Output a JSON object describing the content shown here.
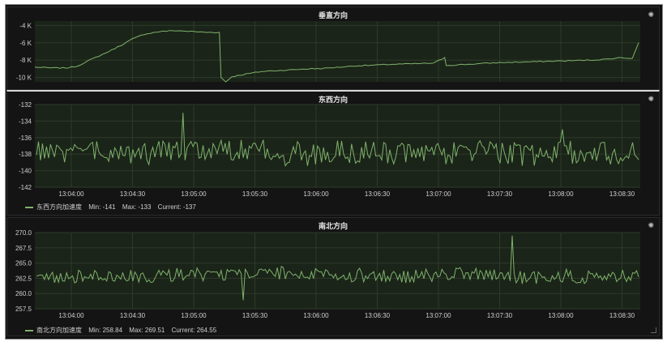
{
  "chart_data": [
    {
      "type": "line",
      "title": "垂直方向",
      "y_ticks": [
        "-4 K",
        "-6 K",
        "-8 K",
        "-10 K"
      ],
      "y_tick_values": [
        -4000,
        -6000,
        -8000,
        -10000
      ],
      "ylim": [
        -10500,
        -3500
      ],
      "xlim": [
        "13:03:30",
        "13:08:48"
      ],
      "series": [
        {
          "values_sketch": [
            [
              0,
              -8800
            ],
            [
              10,
              -8900
            ],
            [
              20,
              -8900
            ],
            [
              27,
              -8700
            ],
            [
              35,
              -8000
            ],
            [
              45,
              -7200
            ],
            [
              55,
              -6300
            ],
            [
              62,
              -5600
            ],
            [
              70,
              -5000
            ],
            [
              80,
              -4700
            ],
            [
              90,
              -4600
            ],
            [
              100,
              -4700
            ],
            [
              110,
              -4800
            ],
            [
              118,
              -4800
            ],
            [
              119,
              -10000
            ],
            [
              122,
              -10500
            ],
            [
              126,
              -9900
            ],
            [
              135,
              -9600
            ],
            [
              145,
              -9300
            ],
            [
              155,
              -9200
            ],
            [
              165,
              -9100
            ],
            [
              175,
              -9000
            ],
            [
              185,
              -8950
            ],
            [
              195,
              -8800
            ],
            [
              205,
              -8650
            ],
            [
              215,
              -8600
            ],
            [
              225,
              -8500
            ],
            [
              235,
              -8450
            ],
            [
              245,
              -8400
            ],
            [
              255,
              -8350
            ],
            [
              262,
              -7700
            ],
            [
              263,
              -8600
            ],
            [
              275,
              -8500
            ],
            [
              285,
              -8400
            ],
            [
              295,
              -8300
            ],
            [
              305,
              -8250
            ],
            [
              315,
              -8200
            ],
            [
              325,
              -8150
            ],
            [
              335,
              -8100
            ],
            [
              345,
              -8050
            ],
            [
              355,
              -8000
            ],
            [
              365,
              -7900
            ],
            [
              375,
              -7700
            ],
            [
              382,
              -7800
            ],
            [
              386,
              -6000
            ]
          ]
        }
      ]
    },
    {
      "type": "line",
      "title": "东西方向",
      "y_ticks": [
        "-132",
        "-134",
        "-136",
        "-138",
        "-140",
        "-142"
      ],
      "y_tick_values": [
        -132,
        -134,
        -136,
        -138,
        -140,
        -142
      ],
      "ylim": [
        -142,
        -132
      ],
      "x_ticks": [
        "13:04:00",
        "13:04:30",
        "13:05:00",
        "13:05:30",
        "13:06:00",
        "13:06:30",
        "13:07:00",
        "13:07:30",
        "13:08:00",
        "13:08:30"
      ],
      "series": [
        {
          "name": "东西方向加速度",
          "min": "-141",
          "max": "-133",
          "current": "-137",
          "mean": -137.8,
          "amplitude": 1.4
        }
      ]
    },
    {
      "type": "line",
      "title": "南北方向",
      "y_ticks": [
        "270.0",
        "267.5",
        "265.0",
        "262.5",
        "260.0",
        "257.5"
      ],
      "y_tick_values": [
        270.0,
        267.5,
        265.0,
        262.5,
        260.0,
        257.5
      ],
      "ylim": [
        257.5,
        270.0
      ],
      "x_ticks": [
        "13:04:00",
        "13:04:30",
        "13:05:00",
        "13:05:30",
        "13:06:00",
        "13:06:30",
        "13:07:00",
        "13:07:30",
        "13:08:00",
        "13:08:30"
      ],
      "series": [
        {
          "name": "南北方向加速度",
          "min": "258.84",
          "max": "269.51",
          "current": "264.55",
          "mean": 262.8,
          "amplitude": 1.1
        }
      ]
    }
  ],
  "legend_labels": {
    "min": "Min:",
    "max": "Max:",
    "current": "Current:"
  },
  "colors": {
    "line": "#7eb26d",
    "grid": "#2e3a2a",
    "plot_bg": "#1b2418"
  },
  "icons": {
    "spinner": "loading-spinner-icon",
    "resize": "resize-handle-icon"
  }
}
